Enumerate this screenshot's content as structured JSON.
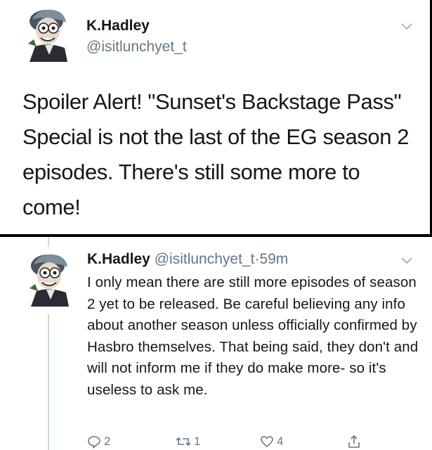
{
  "tweet1": {
    "author_name": "K.Hadley",
    "author_handle": "@isitlunchyet_t",
    "text": "Spoiler Alert! \"Sunset's Backstage Pass\" Special is not the last of the EG season 2 episodes. There's still some more to come!",
    "menu_icon": "chevron-down-icon"
  },
  "tweet2": {
    "author_name": "K.Hadley",
    "author_handle": "@isitlunchyet_t",
    "separator": "·",
    "time": "59m",
    "text": "I only mean there are still more episodes of season 2 yet to be released. Be careful believing any info about another season unless officially confirmed by Hasbro themselves. That being said, they don't and will not inform me if they do make more- so it's useless to ask me.",
    "menu_icon": "chevron-down-icon",
    "actions": {
      "reply_count": "2",
      "retweet_count": "1",
      "like_count": "4"
    }
  },
  "colors": {
    "text": "#14171a",
    "secondary": "#657786",
    "border": "#ccd6dd"
  }
}
